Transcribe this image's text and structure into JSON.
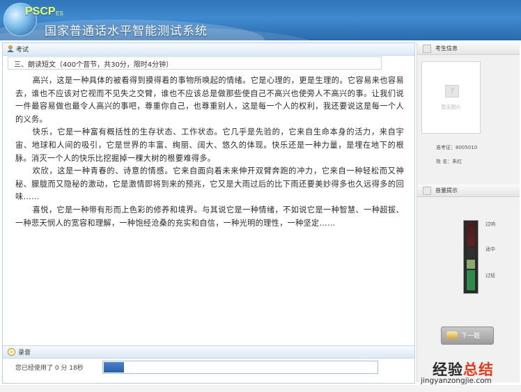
{
  "header": {
    "logo_text": "PSCP",
    "logo_sub": "ES",
    "title": "国家普通话水平智能测试系统"
  },
  "main": {
    "bar_label": "考试",
    "section_title": "三、朗读短文（400个音节，共30分，限时4分钟）",
    "paragraphs": [
      "高兴，这是一种具体的被看得到摸得着的事物所唤起的情绪。它是心理的，更是生理的。它容易来也容易去，谁也不应该对它视而不见失之交臂，谁也不应该总是做那些使自己不高兴也使旁人不高兴的事。让我们说一件最容易做也最令人高兴的事吧，尊重你自己，也尊重别人，这是每一个人的权利，我还要说这是每一个人的义务。",
      "快乐，它是一种富有概括性的生存状态、工作状态。它几乎是先验的，它来自生命本身的活力，来自宇宙、地球和人间的吸引，它是世界的丰富、绚丽、阔大、悠久的体现。快乐还是一种力量，是埋在地下的根脉。消灭一个人的快乐比挖掘掉一棵大树的根要难得多。",
      "欢欣，这是一种青春的、诗意的情感。它来自面向着未来伸开双臂奔跑的冲力，它来自一种轻松而又神秘、朦胧而又隐秘的激动，它是激情即将到来的预兆，它又是大雨过后的比下雨还要美妙得多也久远得多的回味……",
      "喜悦，它是一种带有形而上色彩的修养和境界。与其说它是一种情绪，不如说它是一种智慧、一种超拔、一种悲天悯人的宽容和理解，一种饱经沧桑的充实和自信，一种光明的理性，一种坚定……"
    ],
    "record_label": "录音",
    "used_text": "您已经使用了 0  分 18秒",
    "progress_fraction": 0.075
  },
  "sidebar": {
    "candidate_label": "考生信息",
    "photo_placeholder": "暂无图片",
    "exam_id_line": "准考证：8005010",
    "name_line": "姓   名：朱红",
    "volume_label": "音量提示",
    "vol_levels": [
      "过响",
      "适中",
      "过轻"
    ],
    "next_label": "下一题"
  },
  "watermark": {
    "part1": "经验",
    "part2": "总结",
    "url": "jingyanzongjie.com"
  }
}
